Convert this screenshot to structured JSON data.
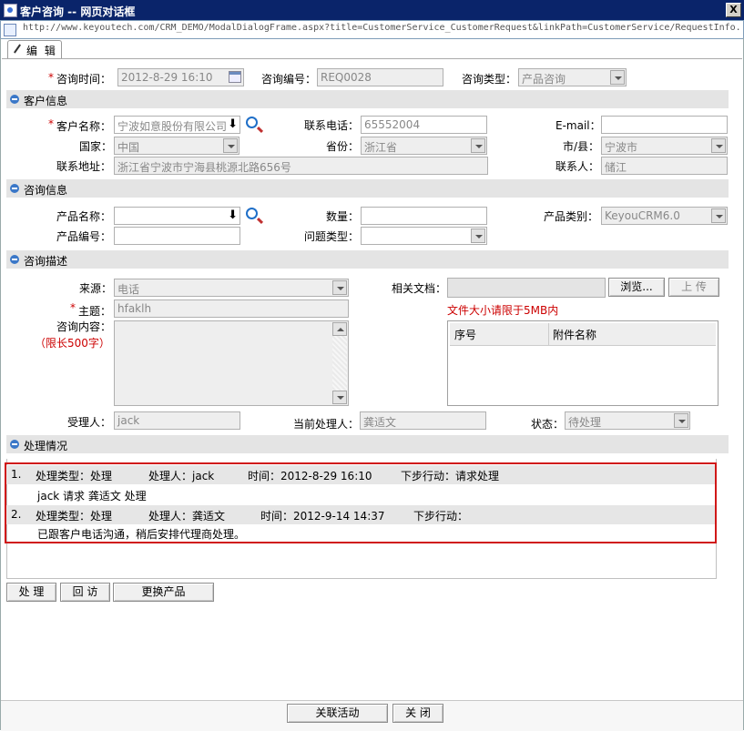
{
  "window": {
    "title": "客户咨询 -- 网页对话框",
    "close": "X",
    "url": "http://www.keyoutech.com/CRM_DEMO/ModalDialogFrame.aspx?title=CustomerService_CustomerRequest&linkPath=CustomerService/RequestInfo."
  },
  "toolbar": {
    "edit_tab": "编 辑"
  },
  "header": {
    "time_label": "咨询时间：",
    "time_value": "2012-8-29 16:10",
    "no_label": "咨询编号：",
    "no_value": "REQ0028",
    "type_label": "咨询类型：",
    "type_value": "产品咨询"
  },
  "customer": {
    "section": "客户信息",
    "name_label": "客户名称：",
    "name_value": "宁波如意股份有限公司",
    "phone_label": "联系电话：",
    "phone_value": "65552004",
    "email_label": "E-mail：",
    "email_value": "",
    "country_label": "国家：",
    "country_value": "中国",
    "province_label": "省份：",
    "province_value": "浙江省",
    "city_label": "市/县：",
    "city_value": "宁波市",
    "address_label": "联系地址：",
    "address_value": "浙江省宁波市宁海县桃源北路656号",
    "contact_label": "联系人：",
    "contact_value": "储江"
  },
  "inquiry": {
    "section": "咨询信息",
    "product_label": "产品名称：",
    "product_value": "",
    "qty_label": "数量：",
    "qty_value": "",
    "category_label": "产品类别：",
    "category_value": "KeyouCRM6.0",
    "code_label": "产品编号：",
    "code_value": "",
    "issue_label": "问题类型：",
    "issue_value": ""
  },
  "description": {
    "section": "咨询描述",
    "source_label": "来源：",
    "source_value": "电话",
    "docs_label": "相关文档：",
    "browse": "浏览...",
    "upload": "上 传",
    "size_note": "文件大小请限于5MB内",
    "subject_label": "主题：",
    "subject_value": "hfaklh",
    "content_label": "咨询内容：",
    "content_limit": "（限长500字）",
    "content_value": "",
    "att_col1": "序号",
    "att_col2": "附件名称",
    "assignee_label": "受理人：",
    "assignee_value": "jack",
    "handler_label": "当前处理人：",
    "handler_value": "龚适文",
    "status_label": "状态：",
    "status_value": "待处理"
  },
  "processing": {
    "section": "处理情况",
    "records": [
      {
        "no": "1.",
        "type": "处理类型：处理",
        "handler": "处理人：jack",
        "time": "时间：2012-8-29 16:10",
        "next": "下步行动：请求处理",
        "detail": "jack 请求 龚适文 处理"
      },
      {
        "no": "2.",
        "type": "处理类型：处理",
        "handler": "处理人：龚适文",
        "time": "时间：2012-9-14 14:37",
        "next": "下步行动：",
        "detail": "已跟客户电话沟通，稍后安排代理商处理。"
      }
    ]
  },
  "actions": {
    "process": "处 理",
    "revisit": "回 访",
    "change_product": "更换产品"
  },
  "footer": {
    "related": "关联活动",
    "close": "关 闭"
  }
}
